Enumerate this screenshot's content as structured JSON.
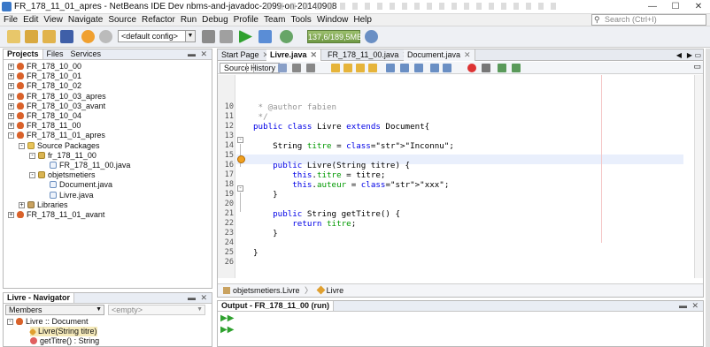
{
  "window": {
    "title": "FR_178_11_01_apres - NetBeans IDE Dev nbms-and-javadoc-2099-on-20140908"
  },
  "menu": [
    "File",
    "Edit",
    "View",
    "Navigate",
    "Source",
    "Refactor",
    "Run",
    "Debug",
    "Profile",
    "Team",
    "Tools",
    "Window",
    "Help"
  ],
  "search": {
    "placeholder": "Search (Ctrl+I)"
  },
  "toolbar": {
    "config": "<default config>",
    "memory": "137,6/189,5MB"
  },
  "projects_panel": {
    "tabs": [
      "Projects",
      "Files",
      "Services"
    ],
    "tree": [
      {
        "label": "FR_178_10_00",
        "level": 0,
        "kind": "project",
        "exp": "+"
      },
      {
        "label": "FR_178_10_01",
        "level": 0,
        "kind": "project",
        "exp": "+"
      },
      {
        "label": "FR_178_10_02",
        "level": 0,
        "kind": "project",
        "exp": "+"
      },
      {
        "label": "FR_178_10_03_apres",
        "level": 0,
        "kind": "project",
        "exp": "+"
      },
      {
        "label": "FR_178_10_03_avant",
        "level": 0,
        "kind": "project",
        "exp": "+"
      },
      {
        "label": "FR_178_10_04",
        "level": 0,
        "kind": "project",
        "exp": "+"
      },
      {
        "label": "FR_178_11_00",
        "level": 0,
        "kind": "project",
        "exp": "+"
      },
      {
        "label": "FR_178_11_01_apres",
        "level": 0,
        "kind": "project",
        "exp": "-"
      },
      {
        "label": "Source Packages",
        "level": 1,
        "kind": "folder",
        "exp": "-"
      },
      {
        "label": "fr_178_11_00",
        "level": 2,
        "kind": "package",
        "exp": "-"
      },
      {
        "label": "FR_178_11_00.java",
        "level": 3,
        "kind": "file",
        "exp": ""
      },
      {
        "label": "objetsmetiers",
        "level": 2,
        "kind": "package",
        "exp": "-"
      },
      {
        "label": "Document.java",
        "level": 3,
        "kind": "file",
        "exp": ""
      },
      {
        "label": "Livre.java",
        "level": 3,
        "kind": "file",
        "exp": ""
      },
      {
        "label": "Libraries",
        "level": 1,
        "kind": "library",
        "exp": "+"
      },
      {
        "label": "FR_178_11_01_avant",
        "level": 0,
        "kind": "project",
        "exp": "+"
      }
    ]
  },
  "navigator": {
    "title": "Livre - Navigator",
    "filter": "Members",
    "empty": "<empty>",
    "items": [
      "Livre :: Document",
      "Livre(String titre)",
      "getTitre() : String"
    ]
  },
  "editor": {
    "tabs": [
      "Start Page",
      "Livre.java",
      "FR_178_11_00.java",
      "Document.java"
    ],
    "source_btn": "Source",
    "history_btn": "History",
    "lines": [
      {
        "n": "10",
        "text": " * @author fabien"
      },
      {
        "n": "11",
        "text": " */"
      },
      {
        "n": "12",
        "text": "public class Livre extends Document{"
      },
      {
        "n": "13",
        "text": ""
      },
      {
        "n": "14",
        "text": "    String titre = \"Inconnu\";"
      },
      {
        "n": "15",
        "text": ""
      },
      {
        "n": "16",
        "text": "    public Livre(String titre) {"
      },
      {
        "n": "17",
        "text": "        this.titre = titre;"
      },
      {
        "n": "18",
        "text": "        this.auteur = \"xxx\";"
      },
      {
        "n": "19",
        "text": "    }"
      },
      {
        "n": "20",
        "text": ""
      },
      {
        "n": "21",
        "text": "    public String getTitre() {"
      },
      {
        "n": "22",
        "text": "        return titre;"
      },
      {
        "n": "23",
        "text": "    }"
      },
      {
        "n": "24",
        "text": ""
      },
      {
        "n": "25",
        "text": "}"
      },
      {
        "n": "26",
        "text": ""
      }
    ],
    "breadcrumbs": [
      "objetsmetiers.Livre",
      "Livre"
    ]
  },
  "output": {
    "title": "Output - FR_178_11_00 (run)"
  }
}
